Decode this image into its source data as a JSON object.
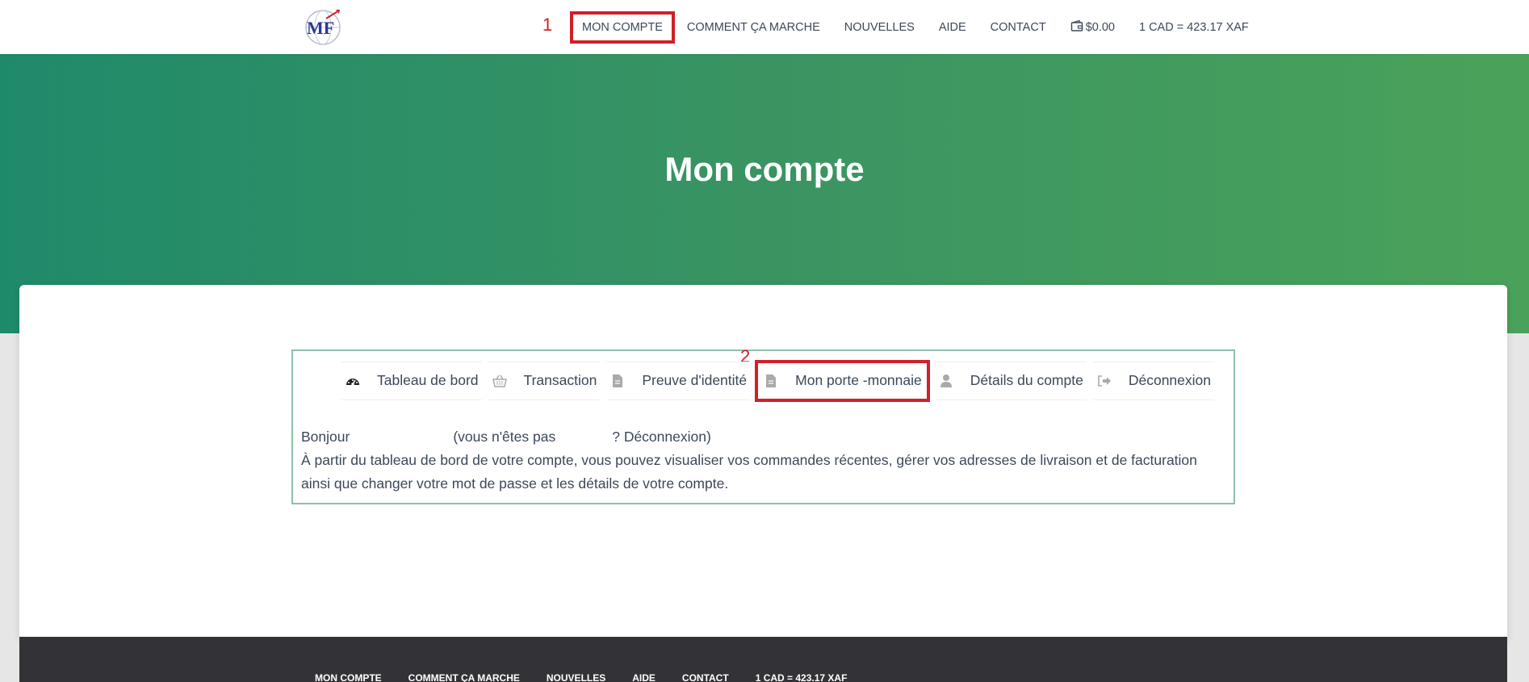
{
  "nav": {
    "items": [
      "MON COMPTE",
      "COMMENT ÇA MARCHE",
      "NOUVELLES",
      "AIDE",
      "CONTACT"
    ],
    "cart_amount": "$0.00",
    "rate": "1 CAD = 423.17 XAF",
    "annotation": "1"
  },
  "hero": {
    "title": "Mon compte"
  },
  "account": {
    "annotation": "2",
    "tabs": [
      {
        "label": "Tableau de bord",
        "icon": "dashboard-icon"
      },
      {
        "label": "Transaction",
        "icon": "basket-icon"
      },
      {
        "label": "Preuve d'identité",
        "icon": "file-icon"
      },
      {
        "label": "Mon porte -monnaie",
        "icon": "file-icon"
      },
      {
        "label": "Détails du compte",
        "icon": "user-icon"
      },
      {
        "label": "Déconnexion",
        "icon": "signout-icon"
      }
    ],
    "hello_prefix": "Bonjour",
    "hello_middle": "(vous n'êtes pas",
    "hello_suffix": "? Déconnexion)",
    "description": "À partir du tableau de bord de votre compte, vous pouvez visualiser vos commandes récentes, gérer vos adresses de livraison et de facturation ainsi que changer votre mot de passe et les détails de votre compte."
  },
  "footer": {
    "items": [
      "MON COMPTE",
      "COMMENT ÇA MARCHE",
      "NOUVELLES",
      "AIDE",
      "CONTACT",
      "1 CAD = 423.17 XAF"
    ]
  }
}
